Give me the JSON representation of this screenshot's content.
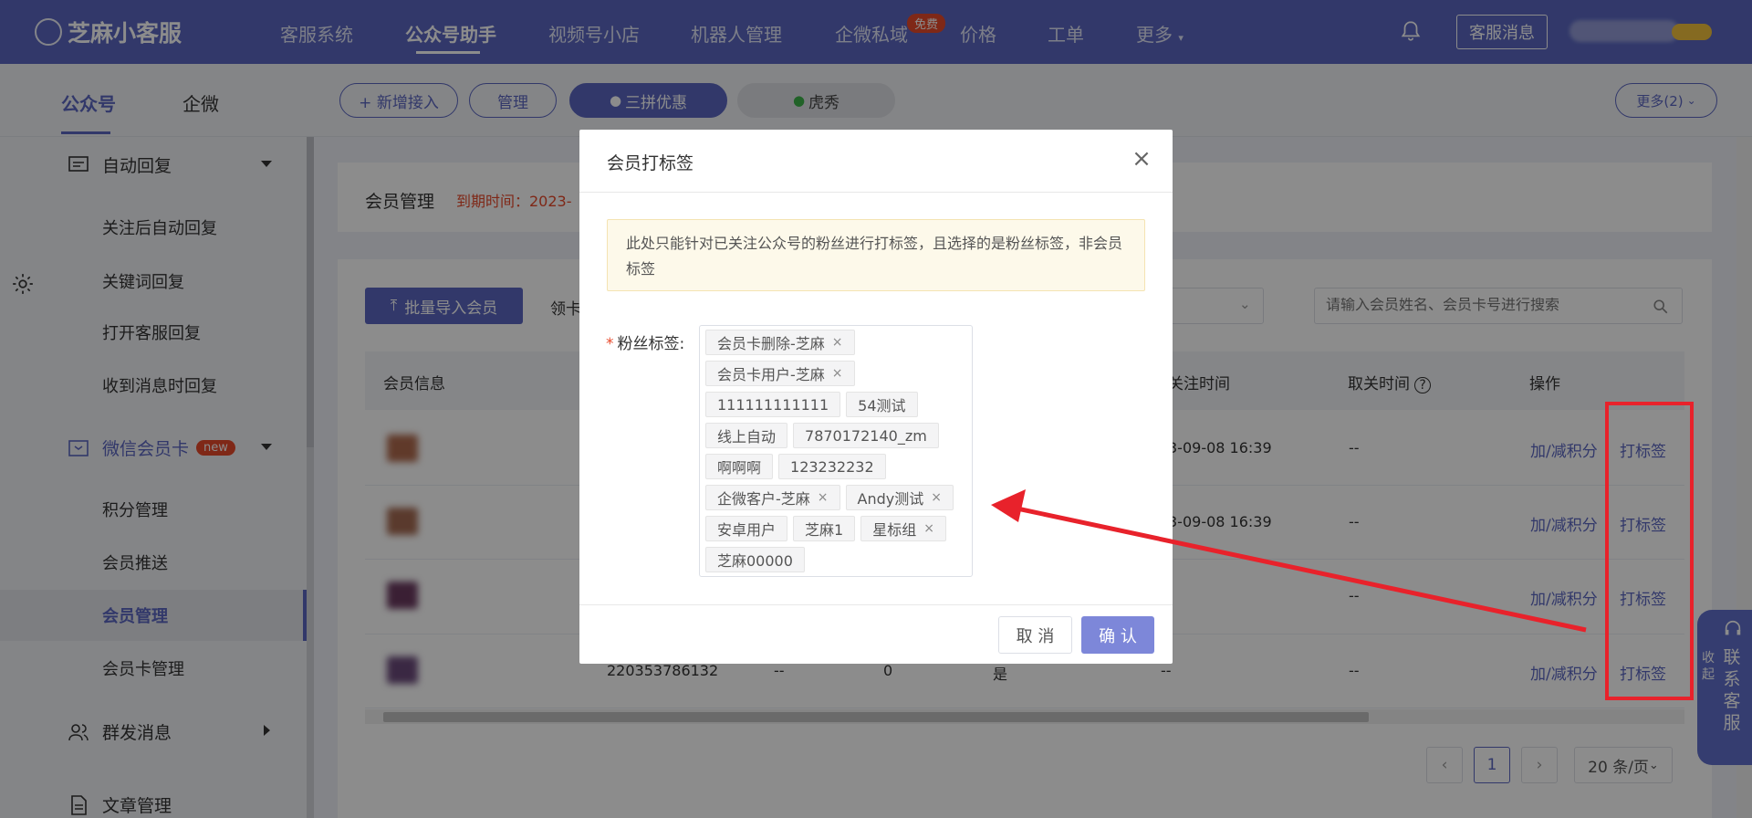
{
  "brand": {
    "name": "芝麻小客服"
  },
  "nav": {
    "items": [
      "客服系统",
      "公众号助手",
      "视频号小店",
      "机器人管理",
      "企微私域",
      "价格",
      "工单",
      "更多"
    ],
    "free_badge": "免费",
    "message_button": "客服消息"
  },
  "subnav": {
    "tabs": [
      "公众号",
      "企微"
    ],
    "add_button": "+ 新增接入",
    "manage_button": "管理",
    "accounts": [
      "三拼优惠",
      "虎秀"
    ],
    "more_button": "更多(2)"
  },
  "sidebar": {
    "auto_reply": "自动回复",
    "auto_reply_items": [
      "关注后自动回复",
      "关键词回复",
      "打开客服回复",
      "收到消息时回复"
    ],
    "member_card": "微信会员卡",
    "new_badge": "new",
    "member_items": [
      "积分管理",
      "会员推送",
      "会员管理",
      "会员卡管理"
    ],
    "mass_message": "群发消息",
    "article": "文章管理"
  },
  "main": {
    "title": "会员管理",
    "expire": "到期时间：2023-",
    "import_button": "批量导入会员",
    "lingka": "领卡",
    "search_placeholder": "请输入会员姓名、会员卡号进行搜索",
    "columns": [
      "会员信息",
      "关注时间",
      "取关时间",
      "操作"
    ],
    "rows": [
      {
        "follow_time": "3-09-08 16:39",
        "unfollow": "--",
        "op1": "加/减积分",
        "op2": "打标签"
      },
      {
        "follow_time": "3-09-08 16:39",
        "unfollow": "--",
        "op1": "加/减积分",
        "op2": "打标签"
      },
      {
        "follow_time": "",
        "unfollow": "--",
        "op1": "加/减积分",
        "op2": "打标签"
      },
      {
        "card": "220353786132",
        "c2": "--",
        "c3": "0",
        "c4": "是",
        "follow_time": "--",
        "unfollow": "--",
        "op1": "加/减积分",
        "op2": "打标签"
      }
    ],
    "pagination": {
      "page": "1",
      "size": "20 条/页"
    }
  },
  "float_service": {
    "collapse": "收起",
    "contact": "联系客服"
  },
  "modal": {
    "title": "会员打标签",
    "notice": "此处只能针对已关注公众号的粉丝进行打标签，且选择的是粉丝标签，非会员标签",
    "label": "粉丝标签:",
    "tags": [
      {
        "text": "会员卡删除-芝麻",
        "selected": true
      },
      {
        "text": "会员卡用户-芝麻",
        "selected": true
      },
      {
        "text": "111111111111",
        "selected": false
      },
      {
        "text": "54测试",
        "selected": false
      },
      {
        "text": "线上自动",
        "selected": false
      },
      {
        "text": "7870172140_zm",
        "selected": false
      },
      {
        "text": "啊啊啊",
        "selected": false
      },
      {
        "text": "123232232",
        "selected": false
      },
      {
        "text": "企微客户-芝麻",
        "selected": true
      },
      {
        "text": "Andy测试",
        "selected": true
      },
      {
        "text": "安卓用户",
        "selected": false
      },
      {
        "text": "芝麻1",
        "selected": false
      },
      {
        "text": "星标组",
        "selected": true
      },
      {
        "text": "芝麻00000",
        "selected": false
      }
    ],
    "cancel": "取 消",
    "confirm": "确 认"
  },
  "colors": {
    "primary": "#5b67c2",
    "danger": "#e8492b",
    "annotation": "#e8222b"
  }
}
